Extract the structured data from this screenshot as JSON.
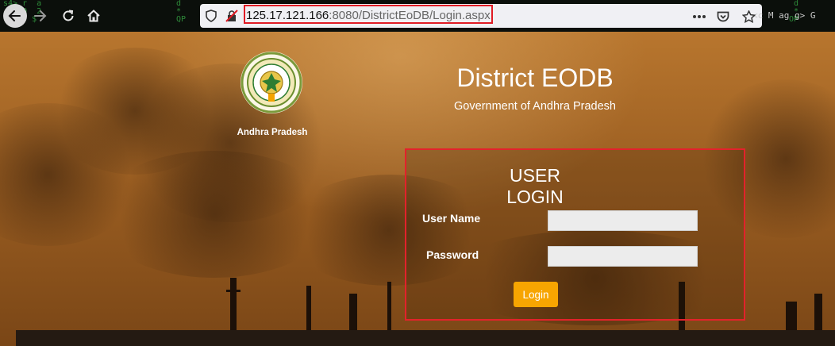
{
  "browser": {
    "url_host": "125.17.121.166",
    "url_path": ":8080/DistrictEoDB/Login.aspx",
    "url_faint_text": "<c  M    ag  g> G",
    "icons": {
      "back": "arrow-left-icon",
      "forward": "arrow-right-icon",
      "reload": "reload-icon",
      "home": "home-icon",
      "tracking": "shield-icon",
      "insecure": "insecure-lock-icon",
      "menu": "more-horizontal-icon",
      "pocket": "pocket-icon",
      "bookmark": "star-icon"
    },
    "highlight_color": "#e01b24"
  },
  "header": {
    "state_name": "Andhra Pradesh",
    "app_title": "District EODB",
    "app_subtitle": "Government of Andhra Pradesh"
  },
  "login": {
    "title": "USER LOGIN",
    "username_label": "User Name",
    "password_label": "Password",
    "username_value": "",
    "password_value": "",
    "button_label": "Login",
    "button_color": "#f7a501",
    "highlight_color": "#e3222b"
  }
}
